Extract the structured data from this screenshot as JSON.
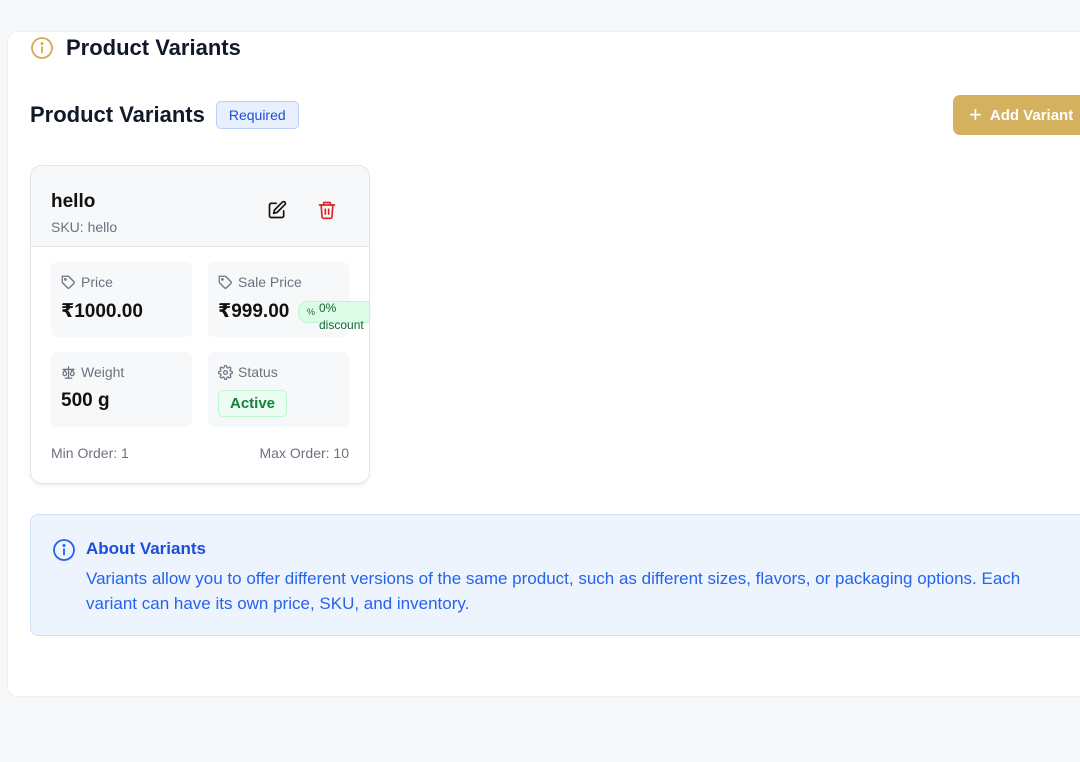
{
  "header": {
    "title": "Product Variants"
  },
  "variants_section": {
    "title": "Product Variants",
    "required_badge": "Required",
    "add_button_label": "Add Variant"
  },
  "variant": {
    "name": "hello",
    "sku": "SKU: hello",
    "price_label": "Price",
    "price_value": "₹1000.00",
    "sale_price_label": "Sale Price",
    "sale_price_value": "₹999.00",
    "discount_icon": "%",
    "discount_text": "0% discount",
    "weight_label": "Weight",
    "weight_value": "500 g",
    "status_label": "Status",
    "status_value": "Active",
    "min_order": "Min Order: 1",
    "max_order": "Max Order: 10"
  },
  "info_box": {
    "title": "About Variants",
    "text": "Variants allow you to offer different versions of the same product, such as different sizes, flavors, or packaging options. Each variant can have its own price, SKU, and inventory."
  },
  "colors": {
    "accent": "#d4b15f",
    "info_blue": "#1d4ed8",
    "delete_red": "#dc2626",
    "status_green": "#15803d"
  },
  "icons": {
    "header": "info-circle-icon",
    "edit": "edit-icon",
    "delete": "trash-icon",
    "price": "tag-icon",
    "sale_price": "tag-icon",
    "weight": "scale-icon",
    "status": "gear-icon",
    "add": "plus-icon",
    "info": "info-circle-icon"
  }
}
